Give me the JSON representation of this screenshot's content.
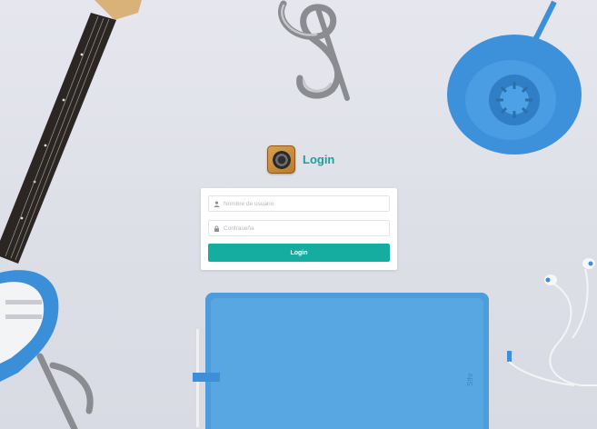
{
  "brand": {
    "title": "Login",
    "logo_icon": "speaker-icon"
  },
  "form": {
    "username_placeholder": "Nombre de usuario",
    "username_icon": "user-icon",
    "password_placeholder": "Contraseña",
    "password_icon": "lock-icon",
    "submit_label": "Login"
  },
  "colors": {
    "accent": "#16ada1",
    "title": "#1f9f97",
    "background": "#dfe1e8"
  }
}
